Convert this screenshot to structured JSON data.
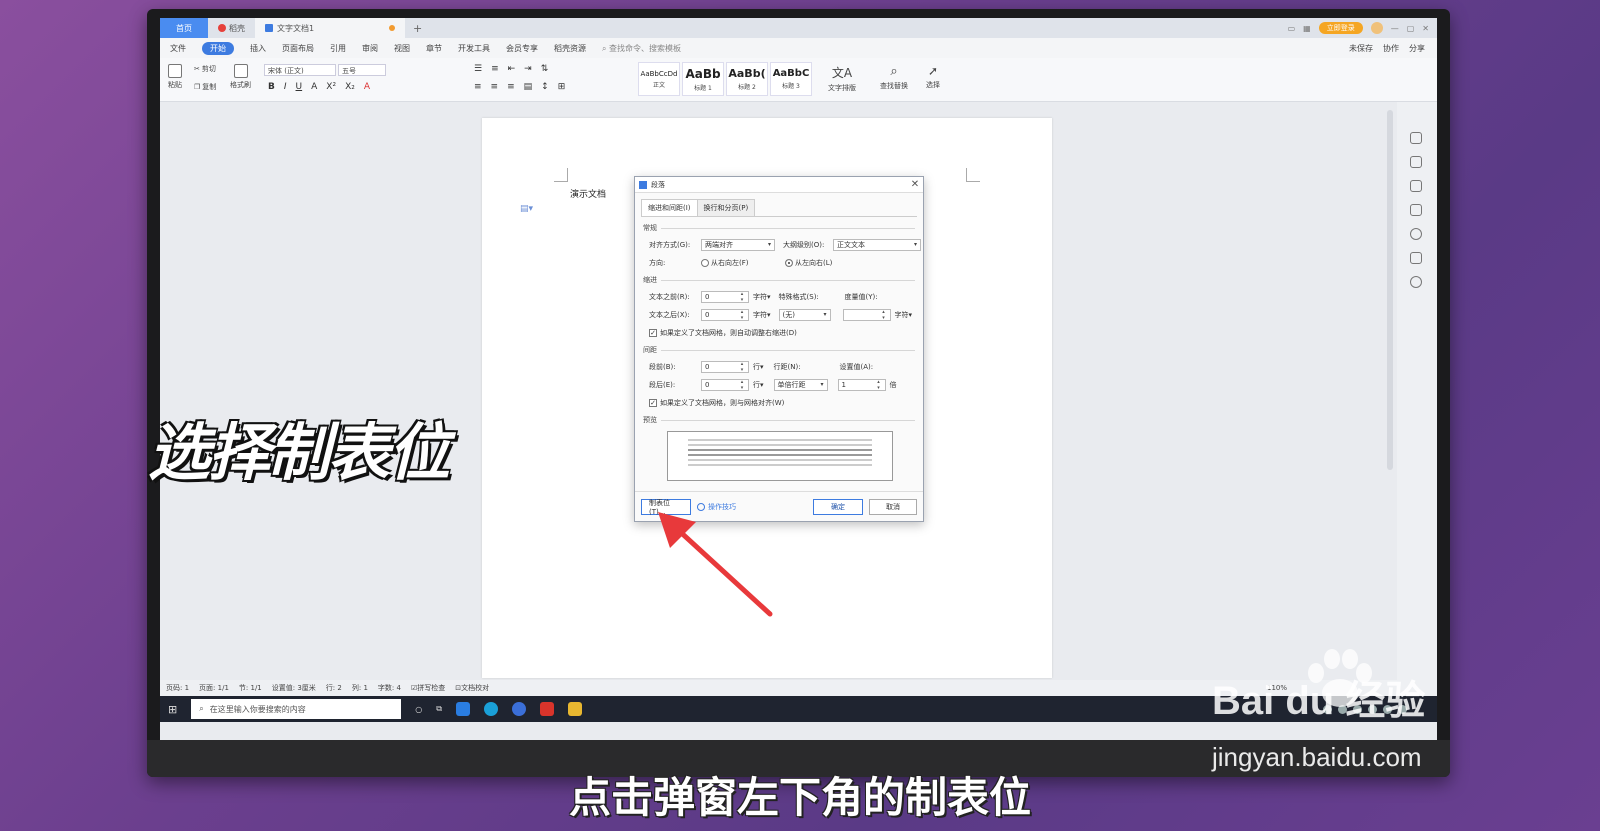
{
  "titlebar": {
    "tabs": [
      "首页",
      "稻壳",
      "文字文档1"
    ],
    "login": "立即登录"
  },
  "menu": {
    "items": [
      "文件",
      "开始",
      "插入",
      "页面布局",
      "引用",
      "审阅",
      "视图",
      "章节",
      "开发工具",
      "会员专享",
      "稻壳资源"
    ],
    "search": "查找命令、搜索模板",
    "right": [
      "未保存",
      "协作",
      "分享"
    ]
  },
  "ribbon": {
    "paste": "粘贴",
    "cut": "剪切",
    "copy": "复制",
    "format_painter": "格式刷",
    "font_name": "宋体 (正文)",
    "font_size": "五号",
    "styles": [
      {
        "preview": "AaBbCcDd",
        "name": "正文"
      },
      {
        "preview": "AaBb",
        "name": "标题 1"
      },
      {
        "preview": "AaBb(",
        "name": "标题 2"
      },
      {
        "preview": "AaBbC",
        "name": "标题 3"
      }
    ],
    "text_layout": "文字排版",
    "find_replace": "查找替换",
    "select": "选择"
  },
  "document": {
    "text": "演示文档"
  },
  "dialog": {
    "title": "段落",
    "tabs": [
      "缩进和间距(I)",
      "换行和分页(P)"
    ],
    "general_label": "常规",
    "align_label": "对齐方式(G):",
    "align_value": "两端对齐",
    "outline_label": "大纲级别(O):",
    "outline_value": "正文文本",
    "direction_label": "方向:",
    "rtl": "从右向左(F)",
    "ltr": "从左向右(L)",
    "indent_label": "缩进",
    "before_text_label": "文本之前(R):",
    "before_text_value": "0",
    "after_text_label": "文本之后(X):",
    "after_text_value": "0",
    "unit_char": "字符▾",
    "special_label": "特殊格式(S):",
    "special_value": "(无)",
    "measure_label": "度量值(Y):",
    "indent_grid_check": "如果定义了文档网格，则自动调整右缩进(D)",
    "spacing_label": "间距",
    "before_label": "段前(B):",
    "before_value": "0",
    "after_label": "段后(E):",
    "after_value": "0",
    "unit_line": "行▾",
    "line_spacing_label": "行距(N):",
    "line_spacing_value": "单倍行距",
    "set_value_label": "设置值(A):",
    "set_value": "1",
    "unit_times": "倍",
    "snap_grid_check": "如果定义了文档网格，则与网格对齐(W)",
    "preview_label": "预览",
    "tabs_button": "制表位(T)...",
    "tips": "操作技巧",
    "ok": "确定",
    "cancel": "取消"
  },
  "statusbar": {
    "items": [
      "页码: 1",
      "页面: 1/1",
      "节: 1/1",
      "设置值: 3厘米",
      "行: 2",
      "列: 1",
      "字数: 4",
      "拼写检查",
      "文档校对"
    ],
    "zoom": "110%"
  },
  "taskbar": {
    "search_placeholder": "在这里输入你要搜索的内容"
  },
  "overlay": {
    "headline": "选择制表位",
    "caption": "点击弹窗左下角的制表位"
  },
  "watermark": {
    "logo": "Bai du 经验",
    "url": "jingyan.baidu.com"
  },
  "colors": {
    "accent": "#3d7be0",
    "arrow": "#e8393b",
    "background": "#6b3f8e"
  }
}
